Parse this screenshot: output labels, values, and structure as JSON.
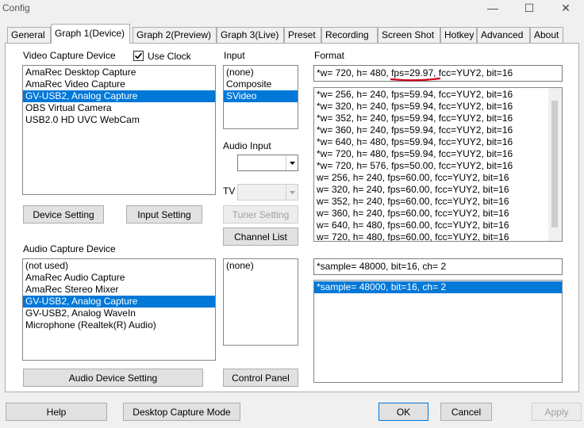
{
  "window": {
    "title": "Config"
  },
  "tabs": [
    {
      "label": "General"
    },
    {
      "label": "Graph 1(Device)"
    },
    {
      "label": "Graph 2(Preview)"
    },
    {
      "label": "Graph 3(Live)"
    },
    {
      "label": "Preset"
    },
    {
      "label": "Recording"
    },
    {
      "label": "Screen Shot"
    },
    {
      "label": "Hotkey"
    },
    {
      "label": "Advanced"
    },
    {
      "label": "About"
    }
  ],
  "video": {
    "section_label": "Video Capture Device",
    "use_clock_label": "Use Clock",
    "use_clock_checked": true,
    "devices": [
      "AmaRec Desktop Capture",
      "AmaRec Video Capture",
      "GV-USB2, Analog Capture",
      "OBS Virtual Camera",
      "USB2.0 HD UVC WebCam"
    ],
    "selected_device": "GV-USB2, Analog Capture",
    "device_setting_label": "Device Setting",
    "input_setting_label": "Input Setting"
  },
  "input": {
    "label": "Input",
    "items": [
      "(none)",
      "Composite",
      "SVideo"
    ],
    "selected": "SVideo",
    "audio_input_label": "Audio Input",
    "tv_label": "TV",
    "tuner_setting_label": "Tuner Setting",
    "channel_list_label": "Channel List"
  },
  "format": {
    "label": "Format",
    "current": "*w= 720, h= 480, fps=29.97, fcc=YUY2, bit=16",
    "annotation_color": "#d0021b",
    "items": [
      "*w= 256, h= 240, fps=59.94, fcc=YUY2, bit=16",
      "*w= 320, h= 240, fps=59.94, fcc=YUY2, bit=16",
      "*w= 352, h= 240, fps=59.94, fcc=YUY2, bit=16",
      "*w= 360, h= 240, fps=59.94, fcc=YUY2, bit=16",
      "*w= 640, h= 480, fps=59.94, fcc=YUY2, bit=16",
      "*w= 720, h= 480, fps=59.94, fcc=YUY2, bit=16",
      "*w= 720, h= 576, fps=50.00, fcc=YUY2, bit=16",
      "w= 256, h= 240, fps=60.00, fcc=YUY2, bit=16",
      "w= 320, h= 240, fps=60.00, fcc=YUY2, bit=16",
      "w= 352, h= 240, fps=60.00, fcc=YUY2, bit=16",
      "w= 360, h= 240, fps=60.00, fcc=YUY2, bit=16",
      "w= 640, h= 480, fps=60.00, fcc=YUY2, bit=16",
      "w= 720, h= 480, fps=60.00, fcc=YUY2, bit=16"
    ]
  },
  "audio": {
    "section_label": "Audio Capture Device",
    "devices": [
      "(not used)",
      "AmaRec Audio Capture",
      "AmaRec Stereo Mixer",
      "GV-USB2, Analog Capture",
      "GV-USB2, Analog WaveIn",
      "Microphone (Realtek(R) Audio)"
    ],
    "selected_device": "GV-USB2, Analog Capture",
    "input_items": [
      "(none)"
    ],
    "device_setting_label": "Audio Device Setting",
    "control_panel_label": "Control Panel",
    "sample_current": "*sample= 48000, bit=16, ch= 2",
    "sample_items": [
      "*sample= 48000, bit=16, ch= 2"
    ],
    "sample_selected": "*sample= 48000, bit=16, ch= 2"
  },
  "footer": {
    "help_label": "Help",
    "desktop_capture_label": "Desktop Capture Mode",
    "ok_label": "OK",
    "cancel_label": "Cancel",
    "apply_label": "Apply"
  }
}
